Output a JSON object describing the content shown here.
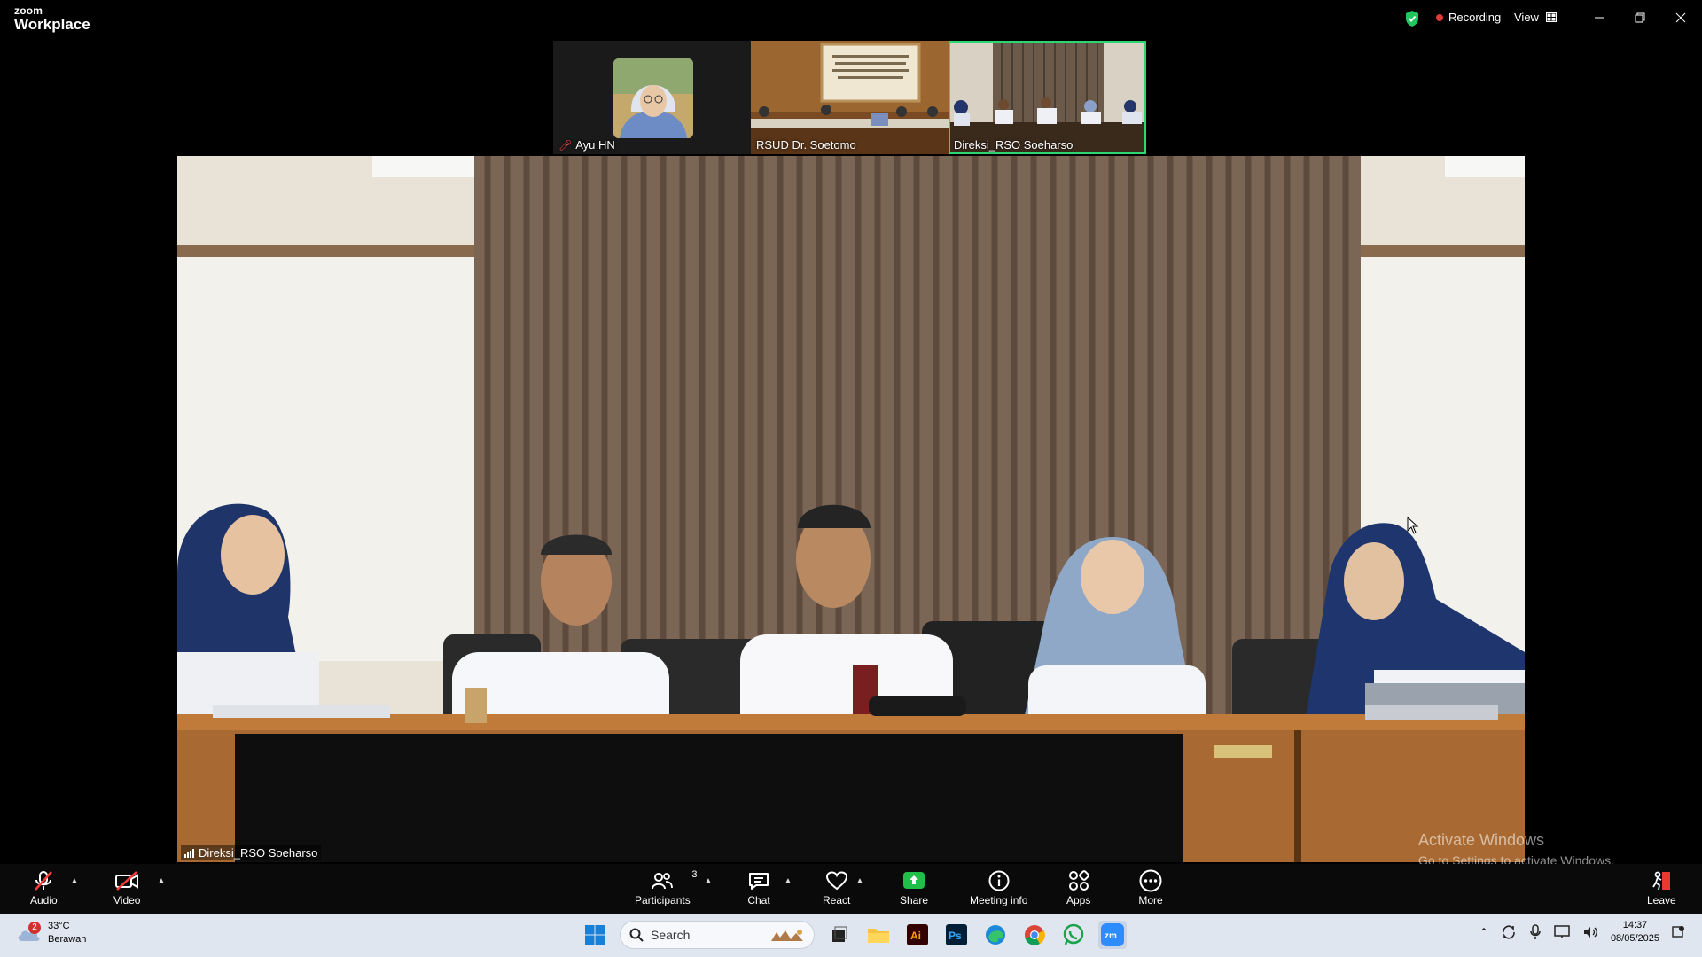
{
  "app": {
    "brand_top": "zoom",
    "brand_bottom": "Workplace"
  },
  "titlebar": {
    "recording_label": "Recording",
    "view_label": "View"
  },
  "thumbnails": [
    {
      "name": "Ayu HN",
      "muted": true
    },
    {
      "name": "RSUD Dr. Soetomo",
      "muted": false
    },
    {
      "name": "Direksi_RSO Soeharso",
      "muted": false,
      "active": true
    }
  ],
  "main_video": {
    "participant_name": "Direksi_RSO Soeharso"
  },
  "watermark": {
    "line1": "Activate Windows",
    "line2": "Go to Settings to activate Windows."
  },
  "toolbar": {
    "audio": "Audio",
    "video": "Video",
    "participants": "Participants",
    "participants_count": "3",
    "chat": "Chat",
    "react": "React",
    "share": "Share",
    "meeting_info": "Meeting info",
    "apps": "Apps",
    "more": "More",
    "leave": "Leave"
  },
  "taskbar": {
    "weather_temp": "33°C",
    "weather_desc": "Berawan",
    "weather_badge": "2",
    "search_placeholder": "Search",
    "time": "14:37",
    "date": "08/05/2025"
  },
  "colors": {
    "active_border": "#2ed573",
    "recording_dot": "#e53935",
    "share_green": "#1fbf4a",
    "leave_red": "#e53935"
  }
}
